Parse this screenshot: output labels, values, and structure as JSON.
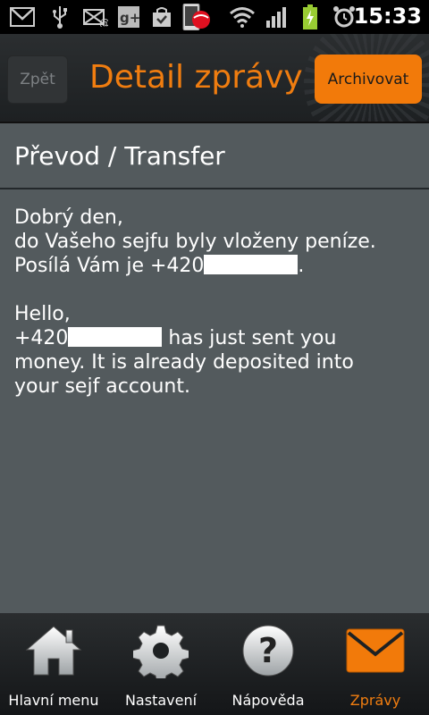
{
  "status_bar": {
    "time": "15:33",
    "icons": [
      "gmail-icon",
      "usb-icon",
      "missed-call-icon",
      "google-plus-icon",
      "shopping-bag-icon",
      "phone-app-icon",
      "wifi-icon",
      "signal-icon",
      "battery-charging-icon",
      "alarm-icon"
    ]
  },
  "header": {
    "back_label": "Zpět",
    "title": "Detail zprávy",
    "archive_label": "Archivovat"
  },
  "message": {
    "subject": "Převod / Transfer",
    "cz_line1": "Dobrý den,",
    "cz_line2": "do Vašeho sejfu byly vloženy peníze.",
    "cz_line3_prefix": "Posílá Vám je +420",
    "cz_line3_suffix": ".",
    "en_line1": "Hello,",
    "en_line2_prefix": "+420",
    "en_line2_suffix": " has just sent you",
    "en_line3": "money. It is already deposited into",
    "en_line4": "your sejf account."
  },
  "bottom_nav": {
    "items": [
      {
        "label": "Hlavní menu",
        "icon": "home-icon"
      },
      {
        "label": "Nastavení",
        "icon": "gear-icon"
      },
      {
        "label": "Nápověda",
        "icon": "help-icon"
      },
      {
        "label": "Zprávy",
        "icon": "envelope-icon",
        "active": true
      }
    ]
  },
  "colors": {
    "accent": "#f07d10",
    "content_bg": "#535a5d",
    "header_bg": "#24272a"
  }
}
